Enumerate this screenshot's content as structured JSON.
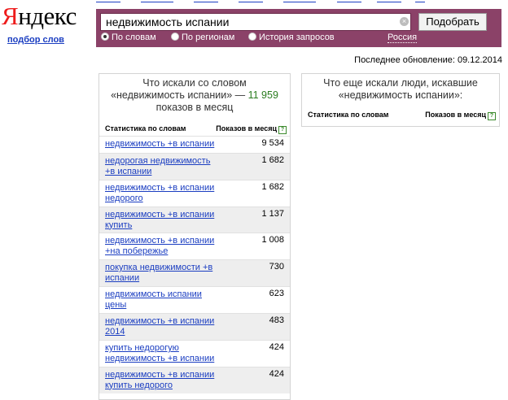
{
  "header": {
    "logo_first": "Я",
    "logo_rest": "ндекс",
    "sublogo": "подбор слов"
  },
  "search": {
    "query": "недвижимость испании",
    "clear_icon": "×",
    "submit_label": "Подобрать",
    "modes": [
      {
        "label": "По словам",
        "selected": true
      },
      {
        "label": "По регионам",
        "selected": false
      },
      {
        "label": "История запросов",
        "selected": false
      }
    ],
    "region": "Россия"
  },
  "updated": "Последнее обновление: 09.12.2014",
  "left_panel": {
    "title_line1": "Что искали со словом",
    "title_line2_pre": "«недвижимость испании» — ",
    "title_count": "11 959",
    "title_line3": "показов в месяц",
    "col_keyword": "Статистика по словам",
    "col_count": "Показов в месяц",
    "help_icon": "?",
    "rows": [
      {
        "keyword": "недвижимость +в испании",
        "count": "9 534"
      },
      {
        "keyword": "недорогая недвижимость +в испании",
        "count": "1 682"
      },
      {
        "keyword": "недвижимость +в испании недорого",
        "count": "1 682"
      },
      {
        "keyword": "недвижимость +в испании купить",
        "count": "1 137"
      },
      {
        "keyword": "недвижимость +в испании +на побережье",
        "count": "1 008"
      },
      {
        "keyword": "покупка недвижимости +в испании",
        "count": "730"
      },
      {
        "keyword": "недвижимость испании цены",
        "count": "623"
      },
      {
        "keyword": "недвижимость +в испании 2014",
        "count": "483"
      },
      {
        "keyword": "купить недорогую недвижимость +в испании",
        "count": "424"
      },
      {
        "keyword": "недвижимость +в испании купить недорого",
        "count": "424"
      }
    ]
  },
  "right_panel": {
    "title_line1": "Что еще искали люди, искавшие",
    "title_line2": "«недвижимость испании»:",
    "col_keyword": "Статистика по словам",
    "col_count": "Показов в месяц",
    "help_icon": "?"
  },
  "colors": {
    "bar": "#8b4268",
    "link": "#1a3dc1",
    "logo_red": "#ee1c1c",
    "count_green": "#2a7c1f"
  }
}
